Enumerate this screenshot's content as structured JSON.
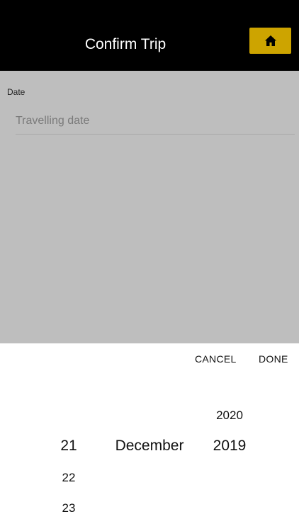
{
  "header": {
    "title": "Confirm Trip",
    "home_icon": "home-icon",
    "accent_color": "#cda400"
  },
  "form": {
    "date_label": "Date",
    "date_placeholder": "Travelling date",
    "date_value": ""
  },
  "picker": {
    "cancel_label": "CANCEL",
    "done_label": "DONE",
    "day": {
      "selected": "21",
      "after": [
        "22",
        "23"
      ]
    },
    "month": {
      "selected": "December"
    },
    "year": {
      "before": [
        "2020"
      ],
      "selected": "2019"
    }
  }
}
